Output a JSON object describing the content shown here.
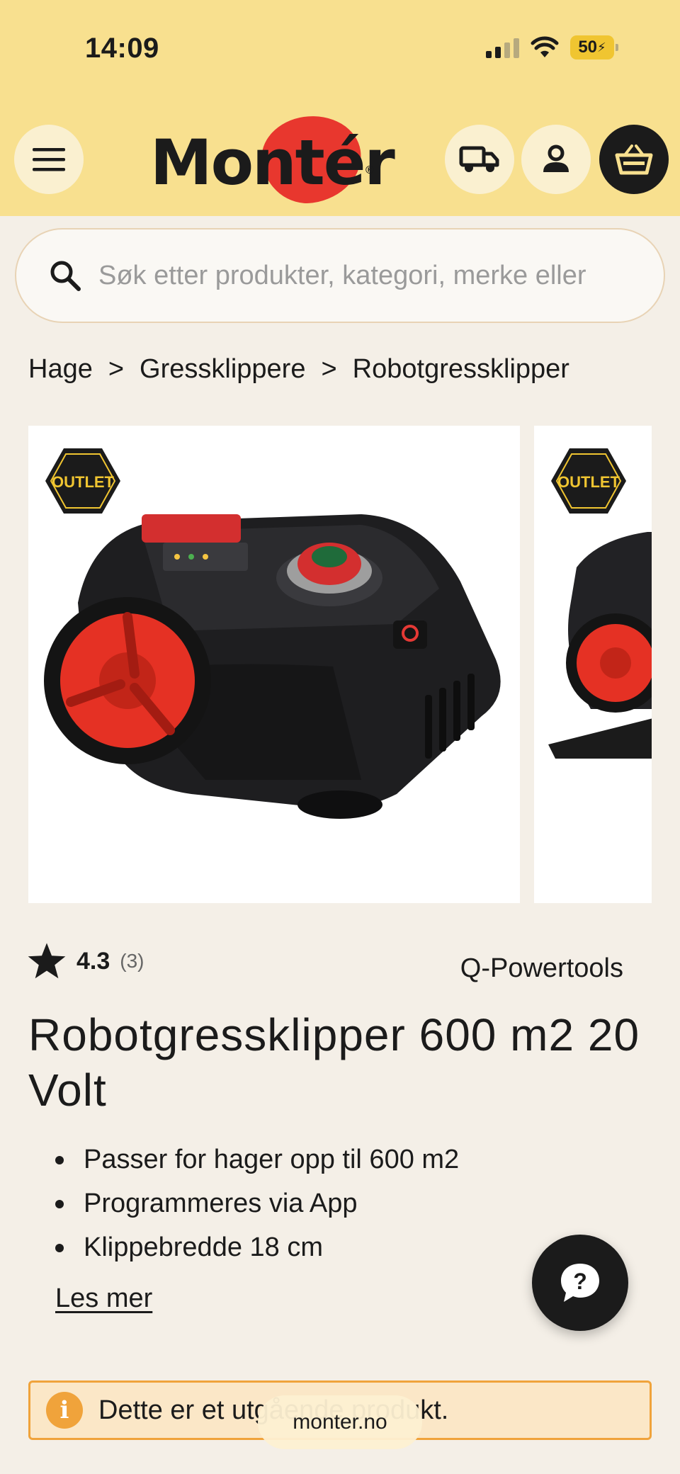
{
  "status_bar": {
    "time": "14:09",
    "battery": "50"
  },
  "header": {
    "logo_text": "Montér",
    "menu_icon": "hamburger-menu-icon",
    "delivery_icon": "truck-icon",
    "account_icon": "user-icon",
    "cart_icon": "basket-icon",
    "colors": {
      "header_bg": "#f8e08f",
      "brand_red": "#e8372e",
      "dark": "#1b1b1b"
    }
  },
  "search": {
    "placeholder": "Søk etter produkter, kategori, merke eller"
  },
  "breadcrumb": {
    "items": [
      "Hage",
      "Gressklippere",
      "Robotgressklipper"
    ],
    "separator": ">"
  },
  "gallery": {
    "badge": "OUTLET"
  },
  "product": {
    "rating": "4.3",
    "rating_count": "(3)",
    "rating_fraction": 0.86,
    "brand": "Q-Powertools",
    "title": "Robotgressklipper 600 m2 20 Volt",
    "bullets": [
      "Passer for hager opp til 600 m2",
      "Programmeres via App",
      "Klippebredde 18 cm"
    ],
    "read_more": "Les mer"
  },
  "notice": {
    "text": "Dette er et utgående produkt.",
    "color": "#f0a33b"
  },
  "browser": {
    "url": "monter.no"
  }
}
